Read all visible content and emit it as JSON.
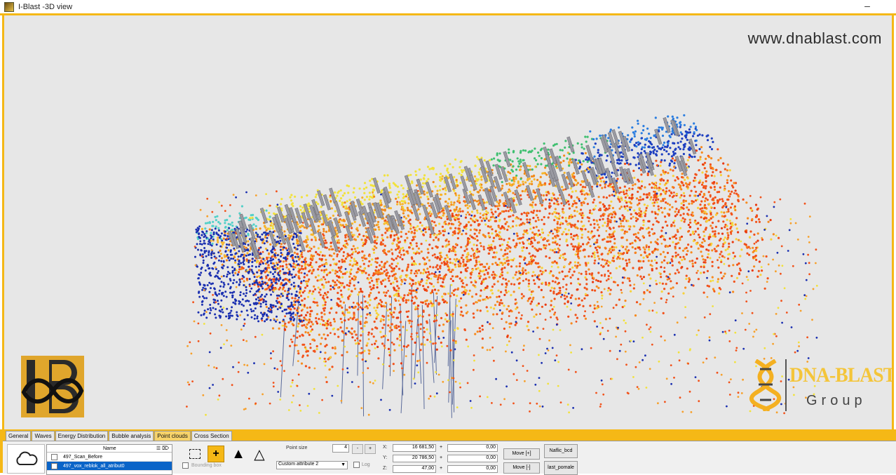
{
  "window": {
    "title": "I-Blast -3D view",
    "minimize_label": "–"
  },
  "viewport": {
    "background": "#e7e7e7",
    "watermark": "www.dnablast.com"
  },
  "logos": {
    "left": {
      "name": "IB logo",
      "color": "#e0a62c"
    },
    "right": {
      "name": "DNA-BLAST",
      "subtitle": "Group",
      "color": "#f4c53a"
    }
  },
  "tabs": [
    "General",
    "Waves",
    "Energy Distribution",
    "Bubble analysis",
    "Point clouds",
    "Cross Section"
  ],
  "active_tab": "Point clouds",
  "cloud_list": {
    "header": "Name",
    "header_icons": "☰ ⌦",
    "rows": [
      {
        "label": "497_Scan_Before",
        "checked": false,
        "selected": false
      },
      {
        "label": "497_vox_reblok_all_atribut0",
        "checked": true,
        "selected": true
      }
    ]
  },
  "toolbar": {
    "select_rect_icon": "dashed-rectangle",
    "add_icon": "+",
    "solid_triangle_icon": "▲",
    "outline_triangle_icon": "△",
    "bounding_box_label": "Bounding box"
  },
  "point_size": {
    "label": "Point size",
    "value": "4",
    "minus": "-",
    "plus": "+"
  },
  "attribute": {
    "selected": "Custom attribute 2",
    "log_label": "Log"
  },
  "coordinates": {
    "x": {
      "label": "X:",
      "value": "16 681,50",
      "offset": "0,00"
    },
    "y": {
      "label": "Y:",
      "value": "20 786,50",
      "offset": "0,00"
    },
    "z": {
      "label": "Z:",
      "value": "47,00",
      "offset": "0,00"
    }
  },
  "buttons": {
    "move_plus": "Move [+]",
    "move_minus": "Move [-]",
    "right_top": "Naflic_bcd",
    "right_bottom": "last_pomale"
  },
  "accent_color": "#f5b816"
}
